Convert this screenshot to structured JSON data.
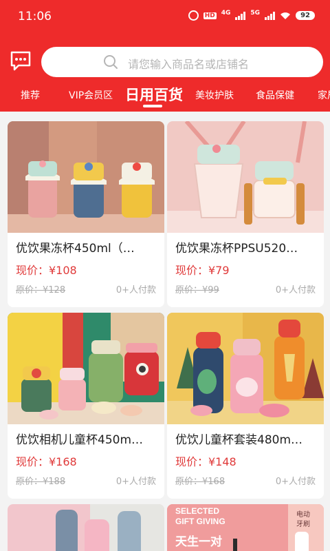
{
  "status_bar": {
    "time": "11:06",
    "hd": "HD",
    "net_4g": "4G",
    "net_5g": "5G",
    "battery": "92"
  },
  "search": {
    "placeholder": "请您输入商品名或店铺名"
  },
  "tabs": [
    {
      "label": "推荐"
    },
    {
      "label": "VIP会员区"
    },
    {
      "label": "日用百货"
    },
    {
      "label": "美妆护肤"
    },
    {
      "label": "食品保健"
    },
    {
      "label": "家居"
    }
  ],
  "products": [
    {
      "name": "优饮果冻杯450ml（…",
      "price": "现价：¥108",
      "original_price": "原价：¥128",
      "sold": "0+人付款"
    },
    {
      "name": "优饮果冻杯PPSU520…",
      "price": "现价：¥79",
      "original_price": "原价：¥99",
      "sold": "0+人付款"
    },
    {
      "name": "优饮相机儿童杯450m…",
      "price": "现价：¥168",
      "original_price": "原价：¥188",
      "sold": "0+人付款"
    },
    {
      "name": "优饮儿童杯套装480m…",
      "price": "现价：¥148",
      "original_price": "原价：¥168",
      "sold": "0+人付款"
    }
  ],
  "promo_card": {
    "line1": "SELECTED",
    "line2": "GIFT GIVING",
    "line3": "天生一对",
    "side_label1": "电动",
    "side_label2": "牙刷"
  },
  "colors": {
    "accent": "#ee2b2b",
    "price": "#e03a3a",
    "muted": "#aaaaaa"
  }
}
